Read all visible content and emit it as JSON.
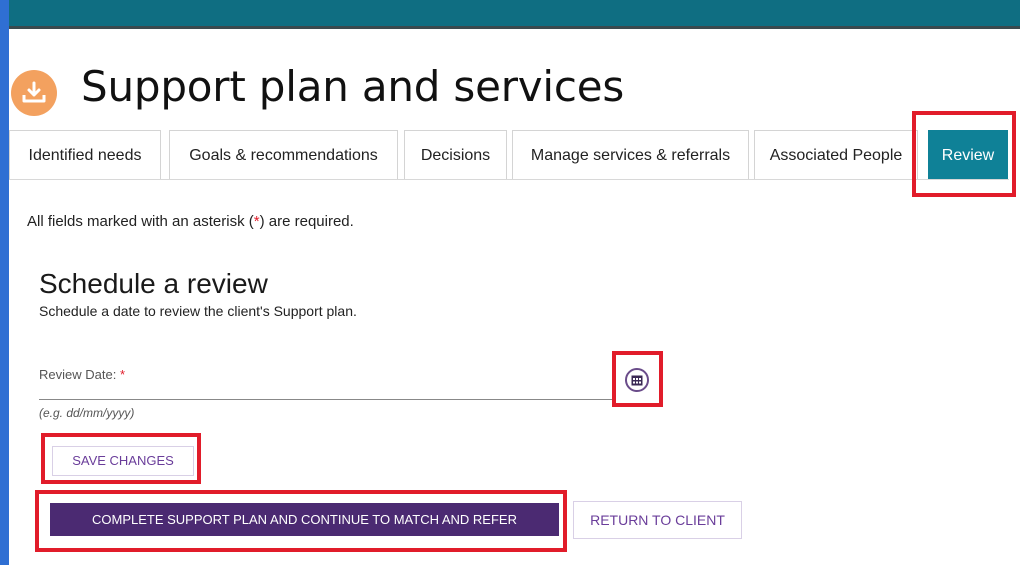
{
  "header": {
    "title": "Support plan and services",
    "icon": "support-plan-icon"
  },
  "tabs": [
    {
      "label": "Identified needs",
      "active": false
    },
    {
      "label": "Goals & recommendations",
      "active": false
    },
    {
      "label": "Decisions",
      "active": false
    },
    {
      "label": "Manage services & referrals",
      "active": false
    },
    {
      "label": "Associated People",
      "active": false
    },
    {
      "label": "Review",
      "active": true
    }
  ],
  "form": {
    "required_note_prefix": "All fields marked with an asterisk (",
    "required_note_asterisk": "*",
    "required_note_suffix": ") are required.",
    "section_title": "Schedule a review",
    "section_subtitle": "Schedule a date to review the client's Support plan.",
    "review_date_label": "Review Date:",
    "required_marker": "*",
    "review_date_value": "",
    "review_date_hint": "(e.g. dd/mm/yyyy)",
    "calendar_icon": "calendar-icon"
  },
  "actions": {
    "save_label": "SAVE CHANGES",
    "complete_label": "COMPLETE SUPPORT PLAN AND CONTINUE TO MATCH AND REFER",
    "return_label": "RETURN TO CLIENT"
  },
  "colors": {
    "accent_teal": "#0f8197",
    "primary_purple": "#4b2a72",
    "highlight_red": "#e11c2a",
    "icon_orange": "#f3a15f"
  }
}
